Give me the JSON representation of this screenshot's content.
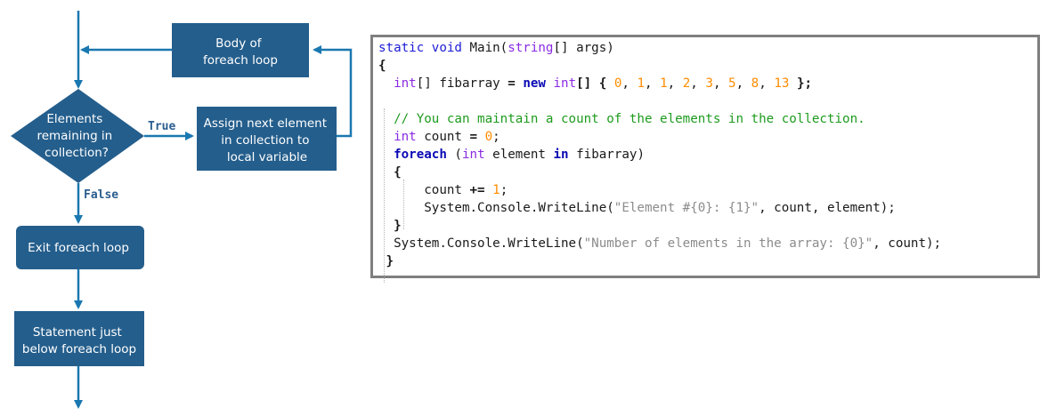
{
  "flowchart": {
    "nodes": {
      "body": [
        "Body of",
        "foreach loop"
      ],
      "condition": [
        "Elements",
        "remaining in",
        "collection?"
      ],
      "assign": [
        "Assign next element",
        "in collection to",
        "local variable"
      ],
      "exit": [
        "Exit foreach loop"
      ],
      "statement": [
        "Statement just",
        "below foreach loop"
      ]
    },
    "edge_labels": {
      "true": "True",
      "false": "False"
    },
    "colors": {
      "node_fill": "#245e8c",
      "arrow": "#1a78b0",
      "label": "#2a5d8f"
    }
  },
  "code": {
    "lines": [
      [
        {
          "t": "static void ",
          "c": "kw"
        },
        {
          "t": "Main("
        },
        {
          "t": "string",
          "c": "ty"
        },
        {
          "t": "[] args)"
        }
      ],
      [
        {
          "t": "{",
          "c": "br"
        }
      ],
      [
        {
          "t": "  "
        },
        {
          "t": "int",
          "c": "ty"
        },
        {
          "t": "[] fibarray "
        },
        {
          "t": "= ",
          "c": "br"
        },
        {
          "t": "new ",
          "c": "kb"
        },
        {
          "t": "int",
          "c": "ty"
        },
        {
          "t": "[] { ",
          "c": "br"
        },
        {
          "t": "0",
          "c": "num"
        },
        {
          "t": ", "
        },
        {
          "t": "1",
          "c": "num"
        },
        {
          "t": ", "
        },
        {
          "t": "1",
          "c": "num"
        },
        {
          "t": ", "
        },
        {
          "t": "2",
          "c": "num"
        },
        {
          "t": ", "
        },
        {
          "t": "3",
          "c": "num"
        },
        {
          "t": ", "
        },
        {
          "t": "5",
          "c": "num"
        },
        {
          "t": ", "
        },
        {
          "t": "8",
          "c": "num"
        },
        {
          "t": ", "
        },
        {
          "t": "13",
          "c": "num"
        },
        {
          "t": " };",
          "c": "br"
        }
      ],
      [],
      [
        {
          "t": "  "
        },
        {
          "t": "// You can maintain a count of the elements in the collection.",
          "c": "cmt"
        }
      ],
      [
        {
          "t": "  "
        },
        {
          "t": "int",
          "c": "ty"
        },
        {
          "t": " count "
        },
        {
          "t": "=",
          "c": "br"
        },
        {
          "t": " "
        },
        {
          "t": "0",
          "c": "num"
        },
        {
          "t": ";"
        }
      ],
      [
        {
          "t": "  "
        },
        {
          "t": "foreach",
          "c": "kb"
        },
        {
          "t": " ("
        },
        {
          "t": "int",
          "c": "ty"
        },
        {
          "t": " element "
        },
        {
          "t": "in",
          "c": "kb"
        },
        {
          "t": " fibarray)"
        }
      ],
      [
        {
          "t": "  "
        },
        {
          "t": "{",
          "c": "br"
        }
      ],
      [
        {
          "t": "      count "
        },
        {
          "t": "+=",
          "c": "br"
        },
        {
          "t": " "
        },
        {
          "t": "1",
          "c": "num"
        },
        {
          "t": ";"
        }
      ],
      [
        {
          "t": "      System.Console.WriteLine("
        },
        {
          "t": "\"Element #{0}: {1}\"",
          "c": "str"
        },
        {
          "t": ", count, element);"
        }
      ],
      [
        {
          "t": "  "
        },
        {
          "t": "}",
          "c": "br"
        }
      ],
      [
        {
          "t": "  System.Console.WriteLine("
        },
        {
          "t": "\"Number of elements in the array: {0}\"",
          "c": "str"
        },
        {
          "t": ", count);"
        }
      ],
      [
        {
          "t": " "
        },
        {
          "t": "}",
          "c": "br"
        }
      ]
    ]
  }
}
